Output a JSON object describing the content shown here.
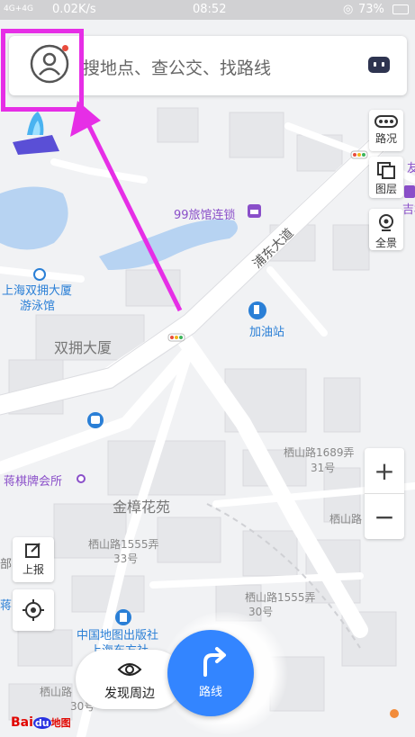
{
  "status_bar": {
    "signal": "4G+4G",
    "speed": "0.02K/s",
    "time": "08:52",
    "battery": "73%"
  },
  "search": {
    "placeholder": "搜地点、查公交、找路线"
  },
  "right_controls": {
    "traffic_label": "路况",
    "layers_label": "图层",
    "panorama_label": "全景"
  },
  "zoom": {
    "in_label": "+",
    "out_label": "−"
  },
  "left_controls": {
    "report_label": "上报"
  },
  "bottom": {
    "discover_label": "发现周边",
    "route_label": "路线"
  },
  "logo": {
    "brand": "Bai",
    "paw": "du",
    "suffix": "地图"
  },
  "map_labels": {
    "hotel": "99旅馆连锁",
    "road": "浦东大道",
    "pool_line1": "上海双拥大厦",
    "pool_line2": "游泳馆",
    "building": "双拥大厦",
    "gas_station": "加油站",
    "chess": "蒋棋牌会所",
    "garden": "金樟花苑",
    "addr_1689_line1": "栖山路1689弄",
    "addr_1689_line2": "31号",
    "addr_1555_line1": "栖山路1555弄",
    "addr_1555_line2": "33号",
    "addr_1555b_line1": "栖山路1555弄",
    "addr_1555b_line2": "30号",
    "addr_right": "栖山路",
    "map_press_line1": "中国地图出版社",
    "map_press_line2": "上海东方社",
    "addr_bottom": "栖山路",
    "addr_bottom2": "30号",
    "edge_right_top": "友",
    "edge_right_mid": "吉林省",
    "edge_left_mid": "部",
    "edge_left_bottom": "蒋"
  },
  "colors": {
    "accent_blue": "#3385ff",
    "highlight_magenta": "#e62ee6",
    "poi_purple": "#8a4fc9",
    "poi_blue": "#2a7fd6",
    "water": "#b7d3f2"
  }
}
